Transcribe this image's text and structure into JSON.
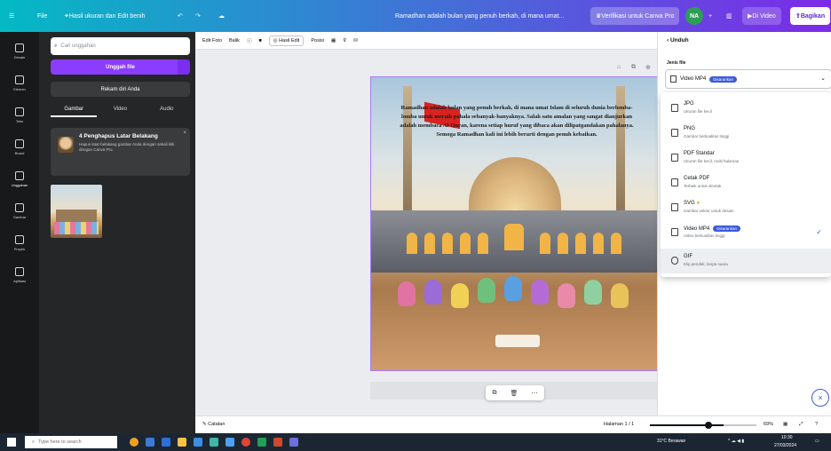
{
  "topbar": {
    "file_label": "File",
    "title": "Hasil ukuran dan Edit benih",
    "doc_title": "Ramadhan adalah bulan yang penuh berkah, di mana umat...",
    "upgrade_label": "Verifikasi untuk Canva Pro",
    "avatar_initials": "NA",
    "share_label": "Bagikan",
    "present_label": "Di Video"
  },
  "rail": {
    "items": [
      "Desain",
      "Elemen",
      "Teks",
      "Brand",
      "Unggahan",
      "Gambar",
      "Proyek",
      "Aplikasi"
    ]
  },
  "panel": {
    "search_placeholder": "Cari unggahan",
    "upload_label": "Unggah file",
    "record_label": "Rekam diri Anda",
    "tabs": [
      "Gambar",
      "Video",
      "Audio"
    ],
    "notice_title": "4 Penghapus Latar Belakang",
    "notice_desc": "Hapus latar belakang gambar Anda dengan sekali klik dengan Canva Pro."
  },
  "toolbar": {
    "edit_label": "Edit Foto",
    "crop_label": "Balik",
    "animate_label": "Hasil Edit",
    "position_label": "Posisi"
  },
  "design": {
    "caption": "Ramadhan adalah bulan yang penuh berkah, di mana umat Islam di seluruh dunia berlomba-lomba untuk meraih pahala sebanyak-banyaknya. Salah satu amalan yang sangat dianjurkan adalah membaca Al-Quran, karena setiap huruf yang dibaca akan dilipatgandakan pahalanya. Semoga Ramadhan kali ini lebih berarti dengan penuh kebaikan."
  },
  "statusbar": {
    "notes_label": "Catatan",
    "page_label": "Halaman 1 / 1",
    "zoom": "69%"
  },
  "download": {
    "header": "Unduh",
    "file_type_label": "Jenis file",
    "selected": "Video MP4",
    "selected_badge": "Disarankan",
    "options": [
      {
        "name": "JPG",
        "desc": "Ukuran file kecil"
      },
      {
        "name": "PNG",
        "desc": "Gambar berkualitas tinggi"
      },
      {
        "name": "PDF Standar",
        "desc": "Ukuran file kecil, multi halaman"
      },
      {
        "name": "Cetak PDF",
        "desc": "Terbaik untuk dicetak"
      },
      {
        "name": "SVG",
        "desc": "Gambar vektor untuk desain"
      },
      {
        "name": "Video MP4",
        "desc": "Video berkualitas tinggi",
        "badge": "Disarankan"
      },
      {
        "name": "GIF",
        "desc": "Klip pendek, tanpa suara"
      }
    ]
  },
  "taskbar": {
    "search_placeholder": "Type here to search",
    "weather": "31°C Berawan",
    "time": "10:30",
    "date": "27/03/2024"
  }
}
